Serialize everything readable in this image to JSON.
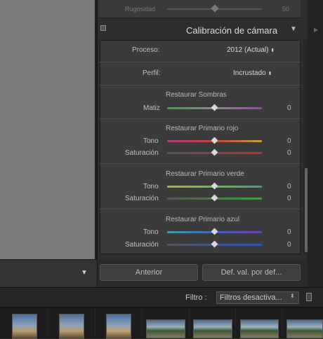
{
  "top_row": {
    "label": "Rugosidad",
    "value": "50"
  },
  "section": {
    "title": "Calibración de cámara"
  },
  "process": {
    "label": "Proceso:",
    "value": "2012 (Actual)"
  },
  "profile": {
    "label": "Perfil:",
    "value": "Incrustado"
  },
  "groups": [
    {
      "title": "Restaurar Sombras",
      "rows": [
        {
          "label": "Matiz",
          "value": "0",
          "level": 0
        }
      ]
    },
    {
      "title": "Restaurar Primario rojo",
      "rows": [
        {
          "label": "Tono",
          "value": "0",
          "level": 0
        },
        {
          "label": "Saturación",
          "value": "0",
          "level": 0
        }
      ]
    },
    {
      "title": "Restaurar Primario verde",
      "rows": [
        {
          "label": "Tono",
          "value": "0",
          "level": 0
        },
        {
          "label": "Saturación",
          "value": "0",
          "level": 0
        }
      ]
    },
    {
      "title": "Restaurar Primario azul",
      "rows": [
        {
          "label": "Tono",
          "value": "0",
          "level": 0
        },
        {
          "label": "Saturación",
          "value": "0",
          "level": 0
        }
      ]
    }
  ],
  "buttons": {
    "previous": "Anterior",
    "defaults": "Def. val. por def..."
  },
  "filter": {
    "label": "Filtro :",
    "value": "Filtros desactiva..."
  },
  "colors": {
    "matiz": "linear-gradient(90deg,#3fa03f,#8a8a8a,#a040b0)",
    "red_tone": "linear-gradient(90deg,#b03a7a,#c04040,#c8a040)",
    "red_sat": "linear-gradient(90deg,#555,#c03030)",
    "green_tone": "linear-gradient(90deg,#b0b040,#60c040,#40a080)",
    "green_sat": "linear-gradient(90deg,#555,#40a040)",
    "blue_tone": "linear-gradient(90deg,#40a0a0,#4060c0,#7040b0)",
    "blue_sat": "linear-gradient(90deg,#555,#3050c0)"
  },
  "icons": {
    "collapse": "triangle-down-icon",
    "section_toggle": "triangle-down-icon",
    "dropdown": "updown-arrows-icon"
  }
}
